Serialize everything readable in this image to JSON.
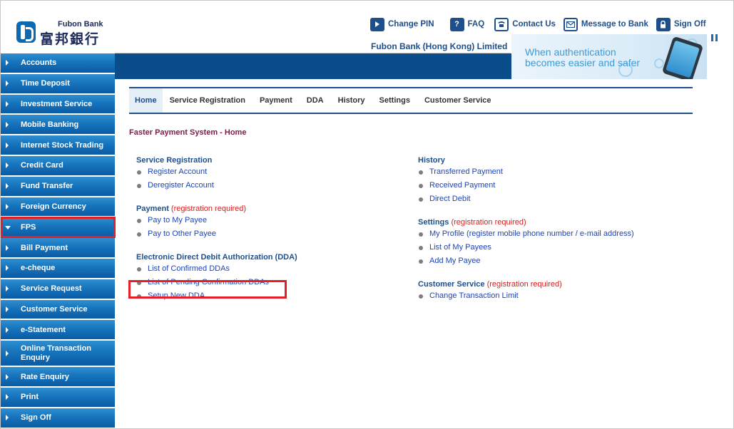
{
  "header": {
    "logo_en": "Fubon Bank",
    "logo_zh": "富邦銀行",
    "company_name": "Fubon Bank (Hong Kong) Limited",
    "links": [
      {
        "label": "Change PIN",
        "icon": "play-icon"
      },
      {
        "label": "FAQ",
        "icon": "question-icon"
      },
      {
        "label": "Contact Us",
        "icon": "telephone-icon"
      },
      {
        "label": "Message to Bank",
        "icon": "envelope-icon"
      },
      {
        "label": "Sign Off",
        "icon": "lock-icon"
      }
    ],
    "faq_glyph": "?"
  },
  "banner": {
    "line1": "When authentication",
    "line2": "becomes easier and safer"
  },
  "sidebar": {
    "items": [
      {
        "label": "Accounts"
      },
      {
        "label": "Time Deposit"
      },
      {
        "label": "Investment Service"
      },
      {
        "label": "Mobile Banking"
      },
      {
        "label": "Internet Stock Trading"
      },
      {
        "label": "Credit Card"
      },
      {
        "label": "Fund Transfer"
      },
      {
        "label": "Foreign Currency"
      },
      {
        "label": "FPS",
        "expanded": true,
        "highlighted": true
      },
      {
        "label": "Bill Payment"
      },
      {
        "label": "e-cheque"
      },
      {
        "label": "Service Request"
      },
      {
        "label": "Customer Service"
      },
      {
        "label": "e-Statement"
      },
      {
        "label": "Online Transaction Enquiry"
      },
      {
        "label": "Rate Enquiry"
      },
      {
        "label": "Print"
      },
      {
        "label": "Sign Off"
      }
    ]
  },
  "tabs": [
    {
      "label": "Home",
      "active": true
    },
    {
      "label": "Service Registration"
    },
    {
      "label": "Payment"
    },
    {
      "label": "DDA"
    },
    {
      "label": "History"
    },
    {
      "label": "Settings"
    },
    {
      "label": "Customer Service"
    }
  ],
  "page_title": "Faster Payment System - Home",
  "left_column": {
    "service_registration": {
      "title": "Service Registration",
      "links": [
        "Register Account",
        "Deregister Account"
      ]
    },
    "payment": {
      "title": "Payment",
      "note": "(registration required)",
      "links": [
        "Pay to My Payee",
        "Pay to Other Payee"
      ]
    },
    "dda": {
      "title": "Electronic Direct Debit Authorization (DDA)",
      "links": [
        "List of Confirmed DDAs",
        "List of Pending Confirmation DDAs",
        "Setup New DDA"
      ]
    }
  },
  "right_column": {
    "history": {
      "title": "History",
      "links": [
        "Transferred Payment",
        "Received Payment",
        "Direct Debit"
      ]
    },
    "settings": {
      "title": "Settings",
      "note": "(registration required)",
      "links": [
        "My Profile (register mobile phone number / e-mail address)",
        "List of My Payees",
        "Add My Payee"
      ]
    },
    "customer_service": {
      "title": "Customer Service",
      "note": "(registration required)",
      "links": [
        "Change Transaction Limit"
      ]
    }
  },
  "colors": {
    "brand_blue": "#1d4f8c",
    "nav_dark": "#0b4d8a",
    "highlight_red": "#e61e25",
    "required_red": "#d42020",
    "link_blue": "#1f44b4",
    "title_maroon": "#7a1c4a"
  }
}
